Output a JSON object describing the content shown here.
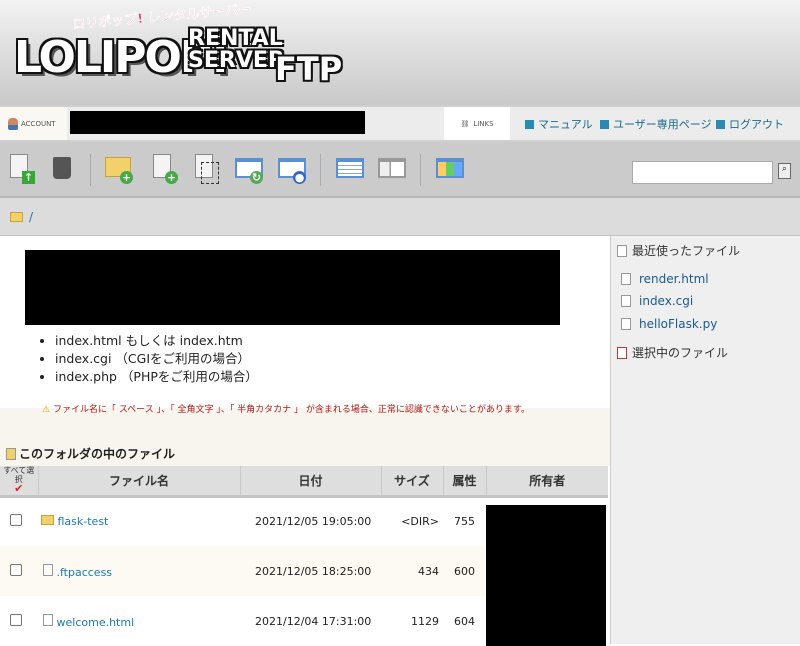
{
  "logo": {
    "jp": "ロリポップ! レンタルサーバー",
    "main": "LOLIPOP!",
    "rental": "RENTAL",
    "server": "SERVER",
    "ftp": "FTP"
  },
  "account": {
    "label": "ACCOUNT"
  },
  "links": {
    "label": "LINKS",
    "items": [
      "マニュアル",
      "ユーザー専用ページ",
      "ログアウト"
    ]
  },
  "search": {
    "value": "",
    "placeholder": ""
  },
  "breadcrumb": {
    "path": "/"
  },
  "index_list": [
    "index.html もしくは index.htm",
    "index.cgi （CGIをご利用の場合）",
    "index.php （PHPをご利用の場合）"
  ],
  "warning": "ファイル名に「 スペース 」、「 全角文字 」、「 半角カタカナ 」 が含まれる場合、正常に認識できないことがあります。",
  "folder_heading": "このフォルダの中のファイル",
  "table": {
    "select_all": "すべて選択",
    "headers": [
      "ファイル名",
      "日付",
      "サイズ",
      "属性",
      "所有者"
    ],
    "rows": [
      {
        "name": "flask-test",
        "date": "2021/12/05 19:05:00",
        "size": "<DIR>",
        "attr": "755",
        "type": "folder"
      },
      {
        "name": ".ftpaccess",
        "date": "2021/12/05 18:25:00",
        "size": "434",
        "attr": "600",
        "type": "file"
      },
      {
        "name": "welcome.html",
        "date": "2021/12/04 17:31:00",
        "size": "1129",
        "attr": "604",
        "type": "file"
      }
    ]
  },
  "sidebar": {
    "recent_title": "最近使ったファイル",
    "recent": [
      "render.html",
      "index.cgi",
      "helloFlask.py"
    ],
    "selected_title": "選択中のファイル"
  }
}
